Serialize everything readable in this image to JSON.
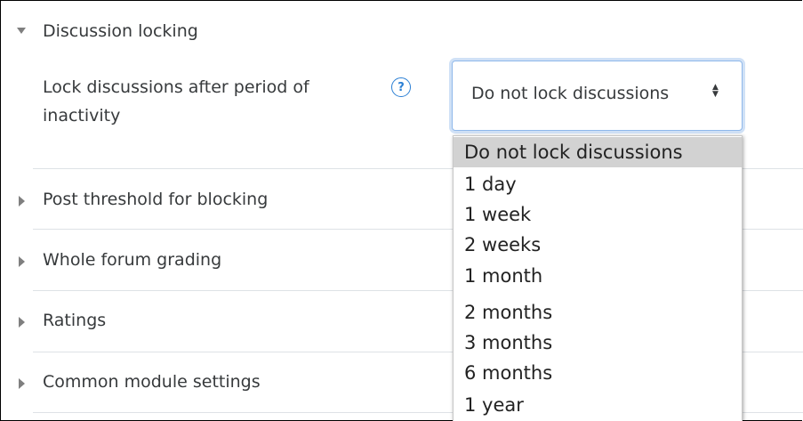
{
  "sections": {
    "discussion_locking": "Discussion locking",
    "post_threshold": "Post threshold for blocking",
    "whole_forum_grading": "Whole forum grading",
    "ratings": "Ratings",
    "common_module": "Common module settings"
  },
  "lock_field": {
    "label": "Lock discussions after period of inactivity",
    "help_glyph": "?",
    "selected_value": "Do not lock discussions"
  },
  "dropdown_options": [
    "Do not lock discussions",
    "1 day",
    "1 week",
    "2 weeks",
    "1 month",
    "2 months",
    "3 months",
    "6 months",
    "1 year"
  ],
  "icons": {
    "expanded": "triangle-down-icon",
    "collapsed": "triangle-right-icon",
    "help": "help-circle-icon",
    "select_arrows": "up-down-arrows-icon"
  },
  "colors": {
    "help_icon": "#2a7fd4",
    "focus_border": "#8fb8ea",
    "selected_option_bg": "#d2d2d2"
  }
}
